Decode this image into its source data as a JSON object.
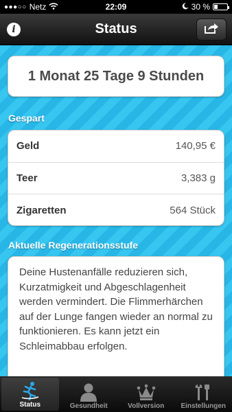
{
  "status_bar": {
    "carrier": "Netz",
    "time": "22:09",
    "battery_label": "30 %",
    "battery_level": 0.3
  },
  "nav": {
    "title": "Status",
    "info_label": "i"
  },
  "time_card": {
    "text": "1 Monat 25 Tage 9 Stunden"
  },
  "saved": {
    "header": "Gespart",
    "rows": [
      {
        "label": "Geld",
        "value": "140,95 €"
      },
      {
        "label": "Teer",
        "value": "3,383 g"
      },
      {
        "label": "Zigaretten",
        "value": "564 Stück"
      }
    ]
  },
  "regeneration": {
    "header": "Aktuelle Regenerationsstufe",
    "text": "Deine Hustenanfälle reduzieren sich, Kurzatmigkeit und Abgeschlagenheit werden vermindert. Die Flimmerhärchen auf der Lunge fangen wieder an normal zu funktionieren. Es kann jetzt ein Schleimabbau erfolgen."
  },
  "tabs": [
    {
      "label": "Status",
      "icon": "running-figure-icon",
      "active": true
    },
    {
      "label": "Gesundheit",
      "icon": "person-icon",
      "active": false
    },
    {
      "label": "Vollversion",
      "icon": "crown-icon",
      "active": false
    },
    {
      "label": "Einstellungen",
      "icon": "tools-icon",
      "active": false
    }
  ],
  "colors": {
    "background_stripe_light": "#36c6f0",
    "background_stripe_dark": "#27b6e6",
    "active_tab_icon": "#2aa8e8"
  }
}
